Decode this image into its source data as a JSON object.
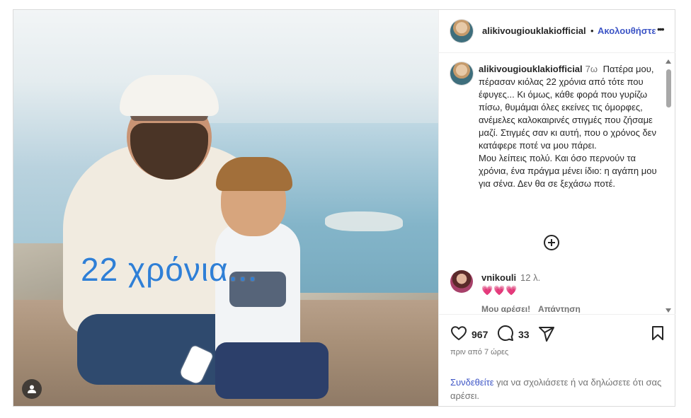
{
  "post": {
    "overlay_text": "22 χρόνια..."
  },
  "header": {
    "username": "alikivougiouklakiofficial",
    "separator": "•",
    "follow_label": "Ακολουθήστε",
    "more_label": "•••"
  },
  "caption": {
    "username": "alikivougiouklakiofficial",
    "time": "7ω",
    "paragraphs": [
      "Πατέρα μου, πέρασαν κιόλας 22 χρόνια από τότε που έφυγες... Κι όμως, κάθε φορά που γυρίζω πίσω, θυμάμαι όλες εκείνες τις όμορφες, ανέμελες καλοκαιρινές στιγμές που ζήσαμε μαζί. Στιγμές σαν κι αυτή, που ο χρόνος δεν κατάφερε ποτέ να μου πάρει.",
      "Μου λείπεις πολύ. Και όσο περνούν τα χρόνια, ένα πράγμα μένει ίδιο: η αγάπη μου για σένα. Δεν θα σε ξεχάσω ποτέ."
    ]
  },
  "comment": {
    "username": "vnikouli",
    "time": "12 λ.",
    "text": "💗💗💗",
    "like_label": "Μου αρέσει!",
    "reply_label": "Απάντηση"
  },
  "actions": {
    "likes": "967",
    "comments": "33",
    "posted": "πριν από 7 ώρες"
  },
  "login": {
    "link": "Συνδεθείτε",
    "text": " για να σχολιάσετε ή να δηλώσετε ότι σας αρέσει."
  },
  "colors": {
    "link_blue": "#3d55c6",
    "overlay_blue": "#2f7fd6",
    "muted": "#737373",
    "heart_pink": "#e0245e"
  },
  "icons": {
    "like": "heart-icon",
    "comment": "comment-bubble-icon",
    "share": "paper-plane-icon",
    "save": "bookmark-icon",
    "load_more": "plus-circle-icon",
    "user_tag": "person-icon"
  }
}
